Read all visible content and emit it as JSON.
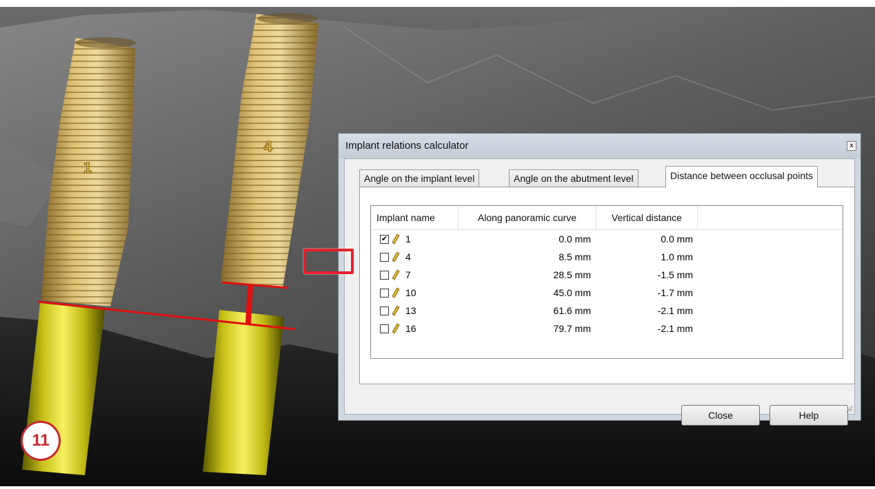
{
  "badge": {
    "number": "11"
  },
  "implant_labels": [
    "1",
    "4"
  ],
  "dialog": {
    "title": "Implant relations calculator",
    "close_glyph": "x",
    "tabs": [
      {
        "label": "Angle on the implant level",
        "active": false
      },
      {
        "label": "Angle on the abutment level",
        "active": false
      },
      {
        "label": "Distance between occlusal points",
        "active": true
      }
    ],
    "columns": [
      "Implant name",
      "Along panoramic curve",
      "Vertical distance"
    ],
    "rows": [
      {
        "checked": true,
        "name": "1",
        "along": "0.0 mm",
        "vertical": "0.0 mm"
      },
      {
        "checked": false,
        "name": "4",
        "along": "8.5 mm",
        "vertical": "1.0 mm"
      },
      {
        "checked": false,
        "name": "7",
        "along": "28.5 mm",
        "vertical": "-1.5 mm"
      },
      {
        "checked": false,
        "name": "10",
        "along": "45.0 mm",
        "vertical": "-1.7 mm"
      },
      {
        "checked": false,
        "name": "13",
        "along": "61.6 mm",
        "vertical": "-2.1 mm"
      },
      {
        "checked": false,
        "name": "16",
        "along": "79.7 mm",
        "vertical": "-2.1 mm"
      }
    ],
    "buttons": {
      "close": "Close",
      "help": "Help"
    }
  },
  "colors": {
    "highlight": "#e5202a",
    "badge": "#c8282f",
    "implant_gold": "#e8c86a",
    "abutment_yellow": "#d8d020"
  }
}
